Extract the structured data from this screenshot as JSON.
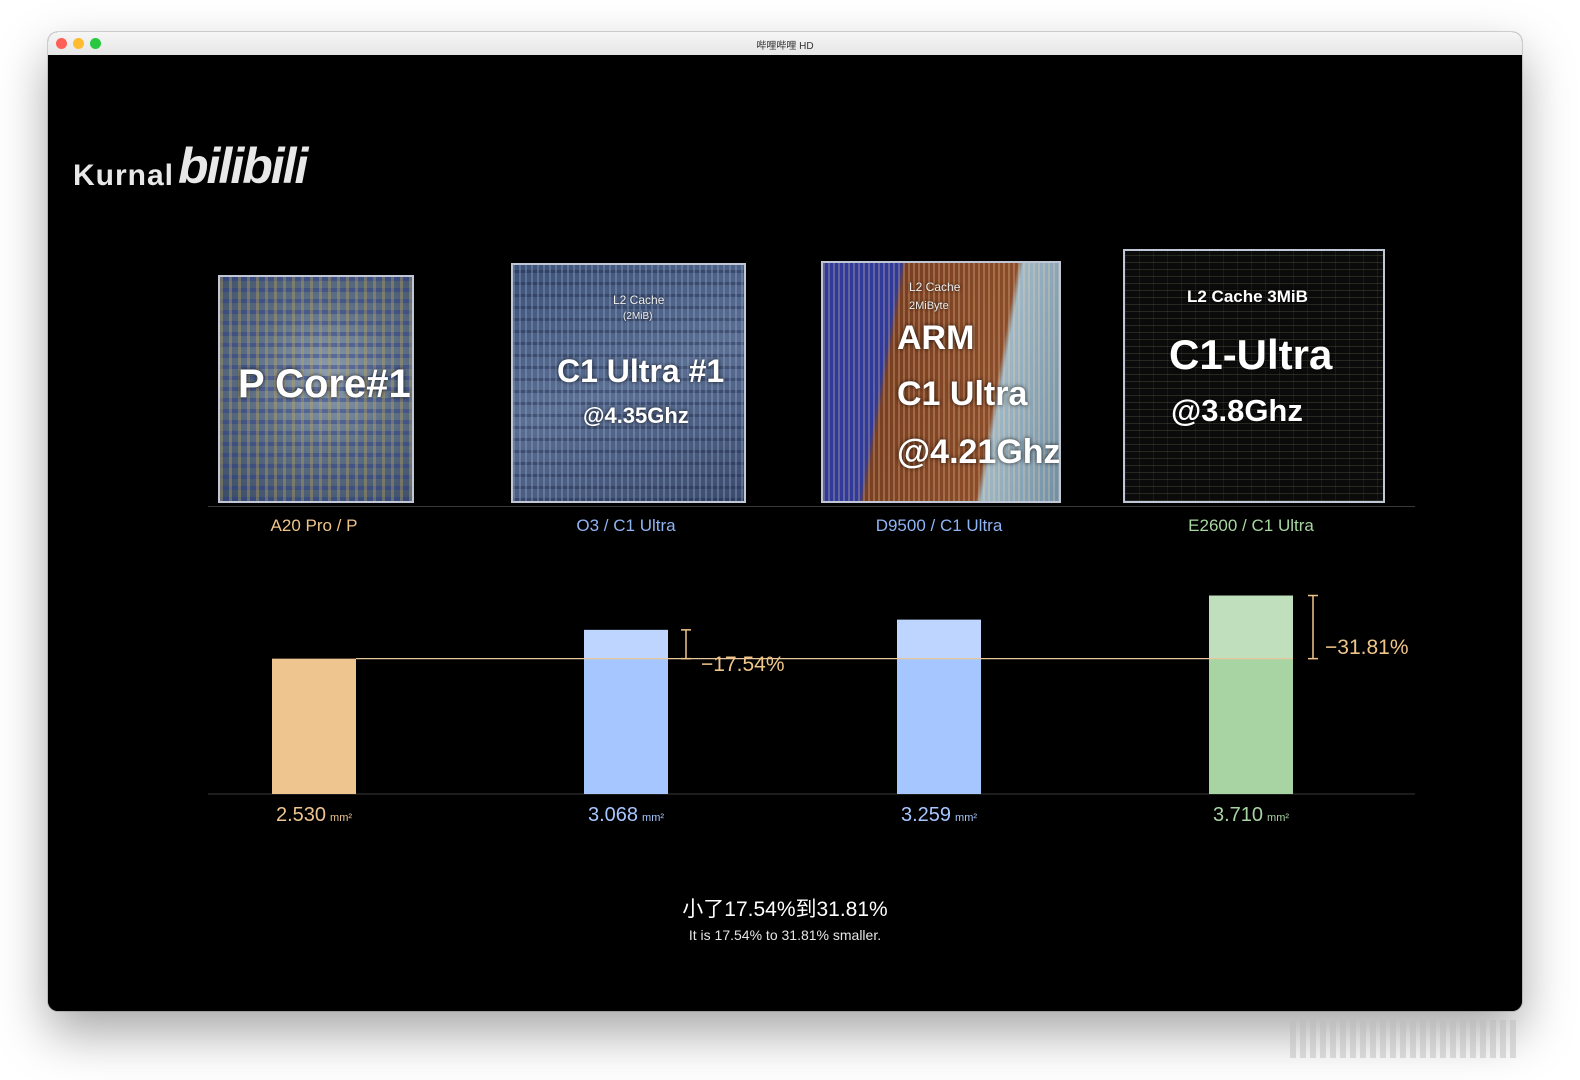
{
  "window": {
    "title": "哔哩哔哩 HD"
  },
  "logo": {
    "author": "Kurnal",
    "brand": "bilibili"
  },
  "chips": [
    {
      "caption": "A20 Pro / P",
      "die_text": [
        "P Core#1"
      ],
      "color": "#f0c58a"
    },
    {
      "caption": "O3 / C1 Ultra",
      "die_text": [
        "L2 Cache",
        "(2MiB)",
        "C1 Ultra #1",
        "@4.35Ghz"
      ],
      "color": "#8fb4f4"
    },
    {
      "caption": "D9500 / C1 Ultra",
      "die_text": [
        "L2 Cache",
        "2MiByte",
        "ARM",
        "C1 Ultra",
        "@4.21Ghz"
      ],
      "color": "#8fb4f4"
    },
    {
      "caption": "E2600 / C1 Ultra",
      "die_text": [
        "L2 Cache 3MiB",
        "C1-Ultra",
        "@3.8Ghz"
      ],
      "color": "#a8d6a0"
    }
  ],
  "chart_data": {
    "type": "bar",
    "categories": [
      "A20 Pro / P",
      "O3 / C1 Ultra",
      "D9500 / C1 Ultra",
      "E2600 / C1 Ultra"
    ],
    "values": [
      2.53,
      3.068,
      3.259,
      3.71
    ],
    "value_labels": [
      "2.530",
      "3.068",
      "3.259",
      "3.710"
    ],
    "unit": "mm²",
    "colors": [
      "#eec48f",
      "#a6c6ff",
      "#a6c6ff",
      "#a8d4a4"
    ],
    "baseline_value": 2.53,
    "reference_line_color": "#e8c89a",
    "annotations": [
      {
        "category_index": 1,
        "text": "−17.54%"
      },
      {
        "category_index": 3,
        "text": "−31.81%"
      }
    ],
    "title": "",
    "xlabel": "",
    "ylabel": ""
  },
  "summary": {
    "cn": "小了17.54%到31.81%",
    "en": "It is 17.54% to 31.81% smaller."
  }
}
